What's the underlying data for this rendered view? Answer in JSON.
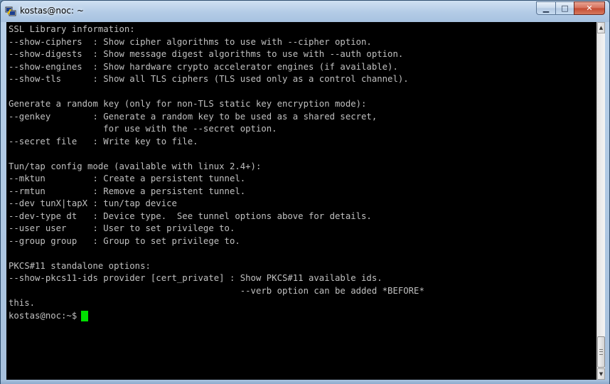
{
  "window": {
    "title": "kostas@noc: ~",
    "app_icon": "putty-icon",
    "controls": {
      "minimize": "▁",
      "maximize": "□",
      "close": "✕"
    }
  },
  "terminal": {
    "lines": [
      "SSL Library information:",
      "--show-ciphers  : Show cipher algorithms to use with --cipher option.",
      "--show-digests  : Show message digest algorithms to use with --auth option.",
      "--show-engines  : Show hardware crypto accelerator engines (if available).",
      "--show-tls      : Show all TLS ciphers (TLS used only as a control channel).",
      "",
      "Generate a random key (only for non-TLS static key encryption mode):",
      "--genkey        : Generate a random key to be used as a shared secret,",
      "                  for use with the --secret option.",
      "--secret file   : Write key to file.",
      "",
      "Tun/tap config mode (available with linux 2.4+):",
      "--mktun         : Create a persistent tunnel.",
      "--rmtun         : Remove a persistent tunnel.",
      "--dev tunX|tapX : tun/tap device",
      "--dev-type dt   : Device type.  See tunnel options above for details.",
      "--user user     : User to set privilege to.",
      "--group group   : Group to set privilege to.",
      "",
      "PKCS#11 standalone options:",
      "--show-pkcs11-ids provider [cert_private] : Show PKCS#11 available ids.",
      "                                            --verb option can be added *BEFORE*",
      "this."
    ],
    "prompt": "kostas@noc:~$",
    "colors": {
      "background": "#000000",
      "foreground": "#c0c0c0",
      "cursor": "#00e000"
    }
  }
}
